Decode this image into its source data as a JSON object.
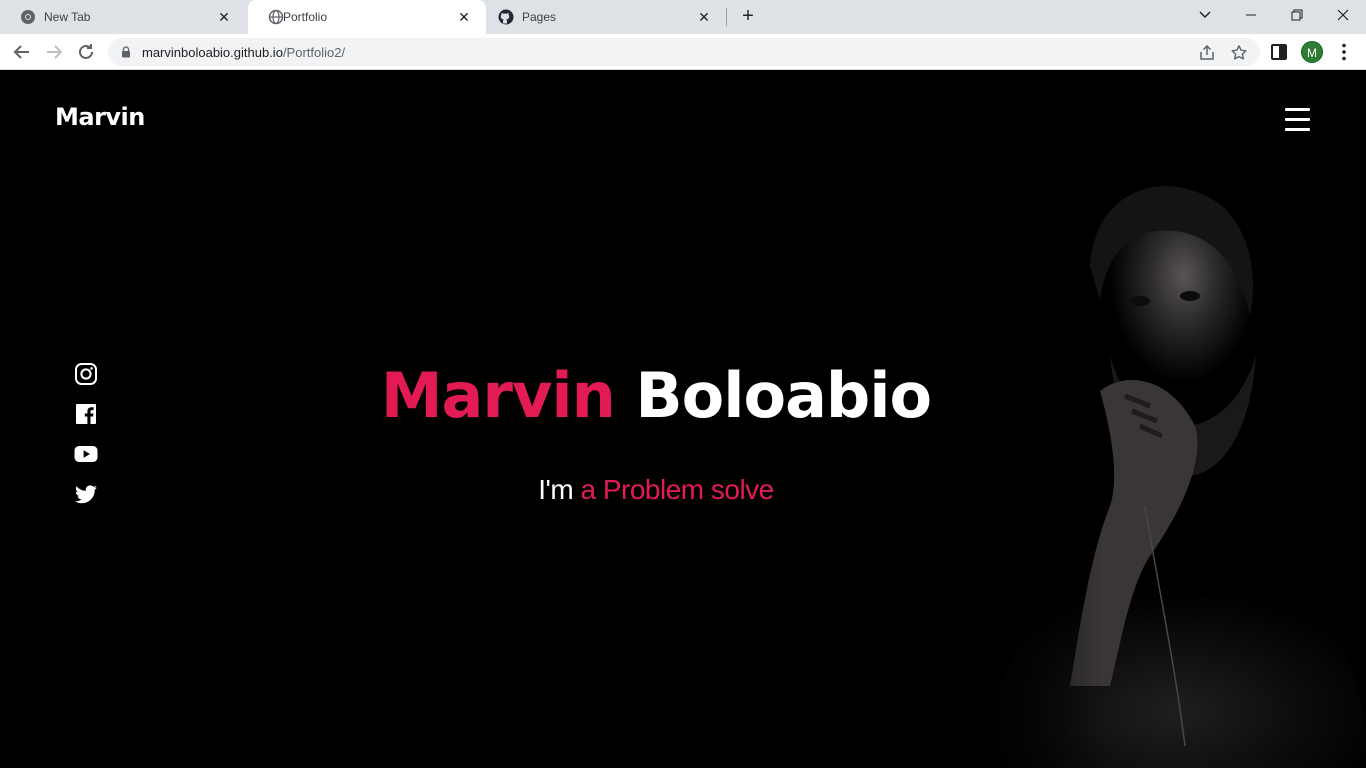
{
  "browser": {
    "tabs": [
      {
        "label": "New Tab",
        "icon": "chrome-icon",
        "active": false
      },
      {
        "label": "Portfolio",
        "icon": "globe-icon",
        "active": true
      },
      {
        "label": "Pages",
        "icon": "github-icon",
        "active": false
      }
    ],
    "url_host": "marvinboloabio.github.io",
    "url_path": "/Portfolio2/",
    "profile_initial": "M"
  },
  "page": {
    "logo": "Marvin",
    "hero": {
      "first_name": "Marvin",
      "last_name": "Boloabio",
      "sub_prefix": "I'm",
      "sub_typed": "a Problem solve"
    },
    "socials": [
      "instagram-icon",
      "facebook-icon",
      "youtube-icon",
      "twitter-icon"
    ],
    "colors": {
      "accent": "#e31b54",
      "background": "#000000",
      "text": "#ffffff"
    }
  }
}
